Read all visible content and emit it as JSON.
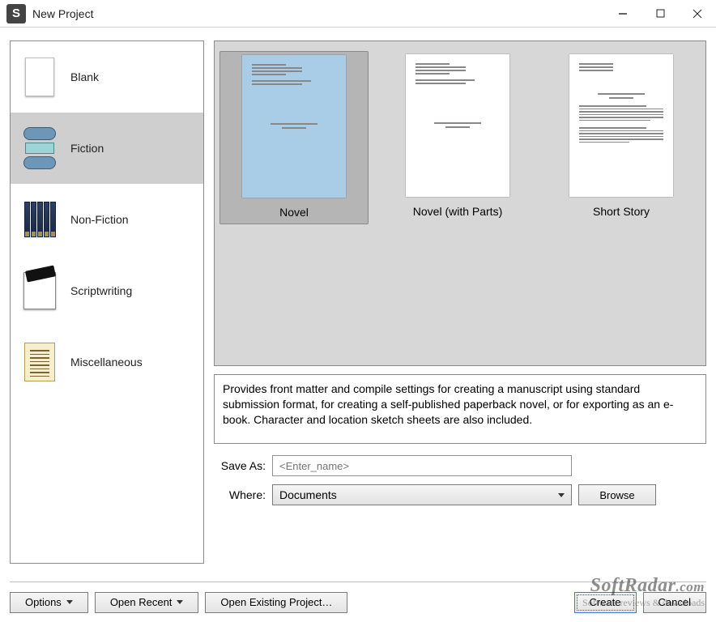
{
  "window": {
    "title": "New Project",
    "app_icon_letter": "S"
  },
  "categories": {
    "items": [
      {
        "label": "Blank",
        "icon": "blank-doc-icon",
        "selected": false
      },
      {
        "label": "Fiction",
        "icon": "fiction-books-icon",
        "selected": true
      },
      {
        "label": "Non-Fiction",
        "icon": "nonfiction-volumes-icon",
        "selected": false
      },
      {
        "label": "Scriptwriting",
        "icon": "clapperboard-icon",
        "selected": false
      },
      {
        "label": "Miscellaneous",
        "icon": "parchment-icon",
        "selected": false
      }
    ]
  },
  "templates": {
    "items": [
      {
        "label": "Novel",
        "selected": true
      },
      {
        "label": "Novel (with Parts)",
        "selected": false
      },
      {
        "label": "Short Story",
        "selected": false
      }
    ]
  },
  "description": "Provides front matter and compile settings for creating a manuscript using standard submission format, for creating a self-published paperback novel, or for exporting as an e-book. Character and location sketch sheets are also included.",
  "form": {
    "save_as_label": "Save As:",
    "save_as_placeholder": "<Enter_name>",
    "save_as_value": "",
    "where_label": "Where:",
    "where_value": "Documents",
    "browse_label": "Browse"
  },
  "bottom_bar": {
    "options_label": "Options",
    "open_recent_label": "Open Recent",
    "open_existing_label": "Open Existing Project…",
    "create_label": "Create",
    "cancel_label": "Cancel"
  },
  "watermark": {
    "big": "SoftRadar",
    "com": ".com",
    "small": "Software reviews & downloads"
  }
}
